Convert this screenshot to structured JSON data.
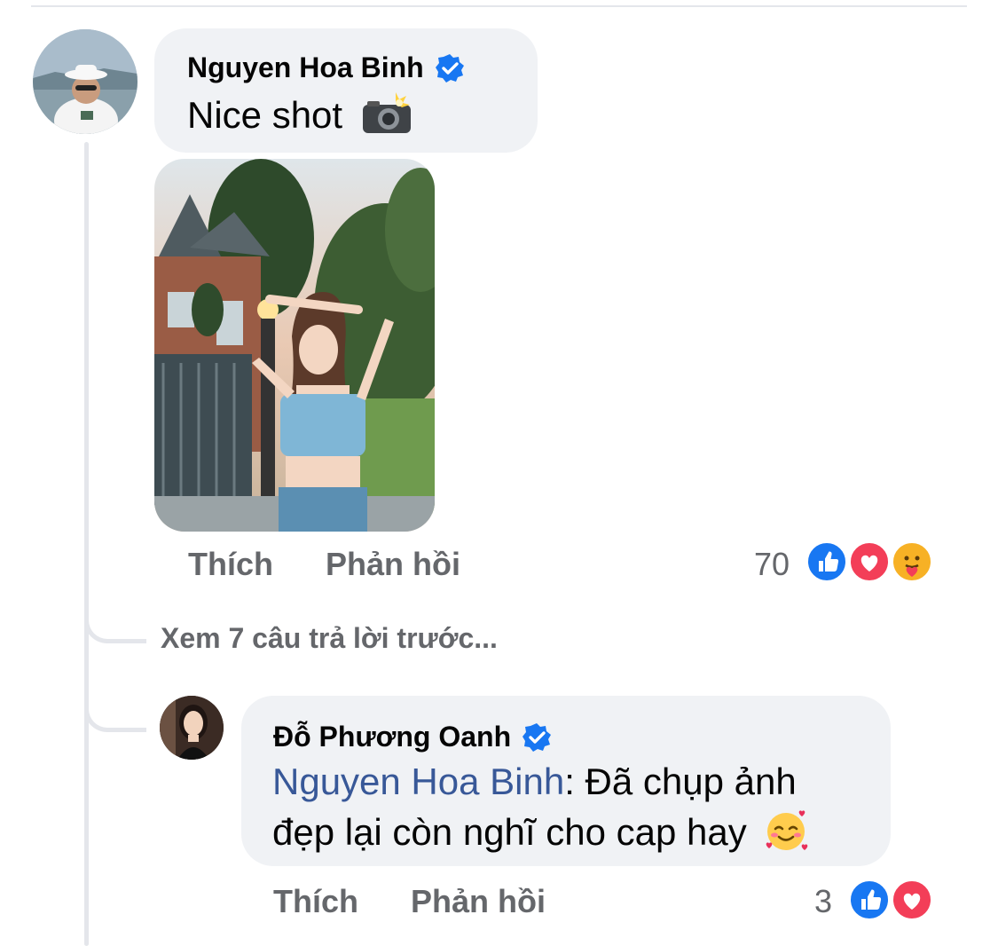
{
  "comment": {
    "author": "Nguyen Hoa Binh",
    "text": "Nice shot",
    "text_emoji": "camera-flash-emoji",
    "verified": true,
    "actions": {
      "like_label": "Thích",
      "reply_label": "Phản hồi"
    },
    "reaction_count": "70",
    "reactions": [
      "like",
      "love",
      "care"
    ]
  },
  "view_previous_replies": "Xem 7 câu trả lời trước...",
  "reply": {
    "author": "Đỗ Phương Oanh",
    "verified": true,
    "mention": "Nguyen Hoa Binh",
    "text_line1": ": Đã chụp ảnh",
    "text_line2": "đẹp lại còn nghĩ cho cap hay",
    "text_emoji": "smiling-face-with-hearts-emoji",
    "actions": {
      "like_label": "Thích",
      "reply_label": "Phản hồi"
    },
    "reaction_count": "3",
    "reactions": [
      "like",
      "love"
    ]
  },
  "colors": {
    "bubble": "#f0f2f5",
    "secondary_text": "#65676b",
    "mention": "#385898",
    "like": "#1877f2",
    "love": "#f33e58",
    "care": "#f7b125",
    "verified": "#1877f2"
  }
}
